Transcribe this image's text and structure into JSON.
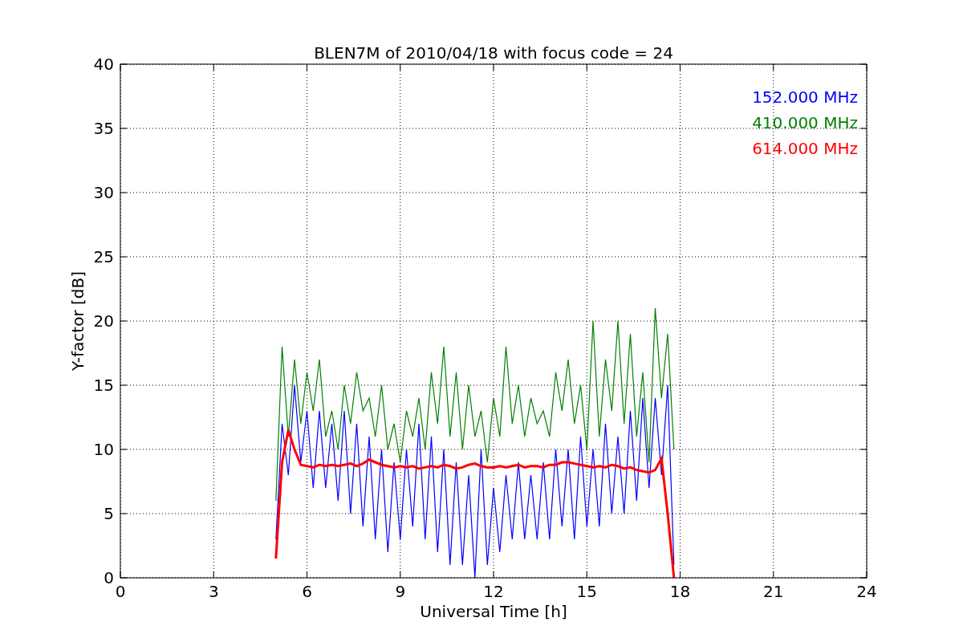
{
  "chart_data": {
    "type": "line",
    "title": "BLEN7M of 2010/04/18 with focus code = 24",
    "xlabel": "Universal Time [h]",
    "ylabel": "Y-factor [dB]",
    "x": [
      5.0,
      5.2,
      5.4,
      5.6,
      5.8,
      6.0,
      6.2,
      6.4,
      6.6,
      6.8,
      7.0,
      7.2,
      7.4,
      7.6,
      7.8,
      8.0,
      8.2,
      8.4,
      8.6,
      8.8,
      9.0,
      9.2,
      9.4,
      9.6,
      9.8,
      10.0,
      10.2,
      10.4,
      10.6,
      10.8,
      11.0,
      11.2,
      11.4,
      11.6,
      11.8,
      12.0,
      12.2,
      12.4,
      12.6,
      12.8,
      13.0,
      13.2,
      13.4,
      13.6,
      13.8,
      14.0,
      14.2,
      14.4,
      14.6,
      14.8,
      15.0,
      15.2,
      15.4,
      15.6,
      15.8,
      16.0,
      16.2,
      16.4,
      16.6,
      16.8,
      17.0,
      17.2,
      17.4,
      17.6,
      17.8
    ],
    "series": [
      {
        "name": "152.000 MHz",
        "color": "#0000ff",
        "values": [
          3,
          12,
          8,
          15,
          9,
          13,
          7,
          13,
          7,
          12,
          6,
          13,
          5,
          12,
          4,
          11,
          3,
          10,
          2,
          9,
          3,
          10,
          4,
          12,
          3,
          11,
          2,
          10,
          1,
          9,
          1,
          8,
          0,
          10,
          1,
          7,
          2,
          8,
          3,
          9,
          3,
          8,
          3,
          9,
          3,
          10,
          4,
          10,
          3,
          11,
          4,
          10,
          4,
          12,
          5,
          11,
          5,
          13,
          6,
          14,
          7,
          14,
          8,
          15,
          1
        ]
      },
      {
        "name": "410.000 MHz",
        "color": "#008000",
        "values": [
          6,
          18,
          11,
          17,
          12,
          16,
          13,
          17,
          11,
          13,
          10,
          15,
          12,
          16,
          13,
          14,
          11,
          15,
          10,
          12,
          9,
          13,
          11,
          14,
          10,
          16,
          12,
          18,
          11,
          16,
          10,
          15,
          11,
          13,
          9,
          14,
          11,
          18,
          12,
          15,
          11,
          14,
          12,
          13,
          11,
          16,
          13,
          17,
          12,
          15,
          10,
          20,
          11,
          17,
          13,
          20,
          12,
          19,
          11,
          16,
          9,
          21,
          14,
          19,
          10
        ]
      },
      {
        "name": "614.000 MHz",
        "color": "#ff0000",
        "values": [
          1.5,
          9,
          11.5,
          10,
          8.8,
          8.7,
          8.6,
          8.8,
          8.7,
          8.8,
          8.7,
          8.8,
          8.9,
          8.7,
          8.9,
          9.2,
          9.0,
          8.8,
          8.7,
          8.6,
          8.7,
          8.6,
          8.7,
          8.5,
          8.6,
          8.7,
          8.6,
          8.8,
          8.7,
          8.5,
          8.6,
          8.8,
          8.9,
          8.7,
          8.6,
          8.6,
          8.7,
          8.6,
          8.7,
          8.8,
          8.6,
          8.7,
          8.7,
          8.6,
          8.8,
          8.8,
          9.0,
          9.0,
          8.9,
          8.8,
          8.7,
          8.6,
          8.7,
          8.6,
          8.8,
          8.7,
          8.5,
          8.6,
          8.4,
          8.3,
          8.2,
          8.4,
          9.3,
          5,
          0
        ]
      }
    ],
    "grid": true,
    "xlim": [
      0,
      24
    ],
    "ylim": [
      0,
      40
    ],
    "xticks": [
      0,
      3,
      6,
      9,
      12,
      15,
      18,
      21,
      24
    ],
    "yticks": [
      0,
      5,
      10,
      15,
      20,
      25,
      30,
      35,
      40
    ]
  }
}
